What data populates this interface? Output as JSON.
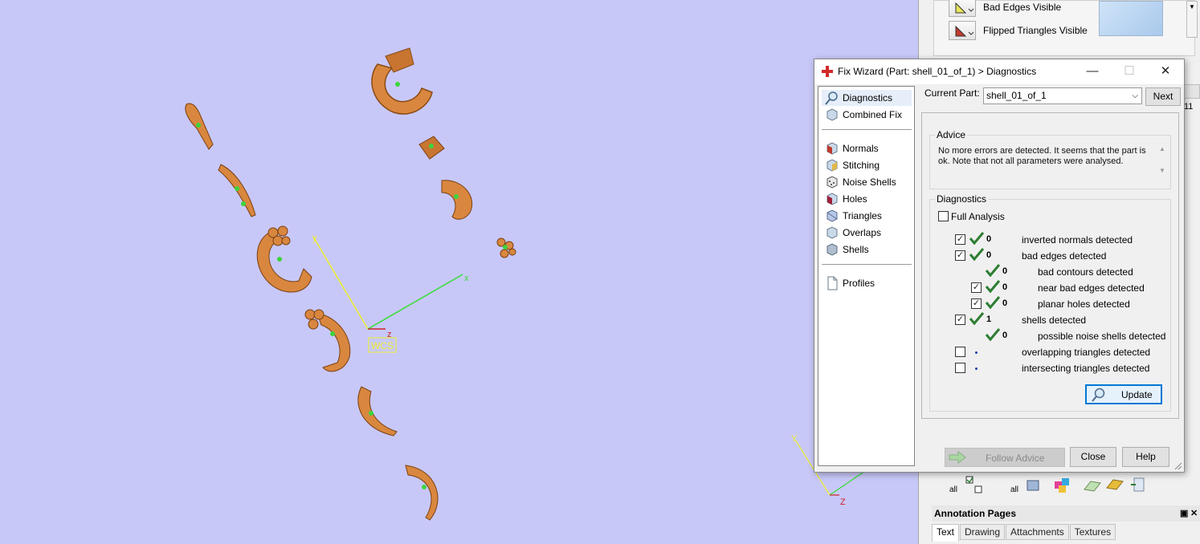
{
  "viewport": {
    "axis_labels": {
      "x": "x",
      "y": "y",
      "z": "z",
      "wcs": "WCS",
      "small_y": "Y",
      "small_z": "Z"
    }
  },
  "right_panel": {
    "bad_edges_label": "Bad Edges Visible",
    "flipped_label": "Flipped Triangles Visible",
    "tool_all_1": "all",
    "tool_all_2": "all",
    "annotation_title": "Annotation Pages",
    "annotation_tabs": [
      "Text",
      "Drawing",
      "Attachments",
      "Textures"
    ],
    "stub_tab_11": "11"
  },
  "dialog": {
    "title": "Fix Wizard (Part: shell_01_of_1) > Diagnostics",
    "nav": {
      "diagnostics": "Diagnostics",
      "combined_fix": "Combined Fix",
      "normals": "Normals",
      "stitching": "Stitching",
      "noise_shells": "Noise Shells",
      "holes": "Holes",
      "triangles": "Triangles",
      "overlaps": "Overlaps",
      "shells": "Shells",
      "profiles": "Profiles"
    },
    "current_part_label": "Current Part:",
    "current_part_value": "shell_01_of_1",
    "next_label": "Next",
    "advice_title": "Advice",
    "advice_text": "No more errors are detected. It seems that the part is ok. Note that not all parameters were analysed.",
    "diagnostics_title": "Diagnostics",
    "full_analysis_label": "Full Analysis",
    "rows": [
      {
        "count": "0",
        "label": "inverted normals detected"
      },
      {
        "count": "0",
        "label": "bad edges detected"
      },
      {
        "count": "0",
        "label": "bad contours detected"
      },
      {
        "count": "0",
        "label": "near bad edges detected"
      },
      {
        "count": "0",
        "label": "planar holes detected"
      },
      {
        "count": "1",
        "label": "shells detected"
      },
      {
        "count": "0",
        "label": "possible noise shells detected"
      },
      {
        "count": "",
        "label": "overlapping triangles detected"
      },
      {
        "count": "",
        "label": "intersecting triangles detected"
      }
    ],
    "update_label": "Update",
    "follow_advice_label": "Follow Advice",
    "close_label": "Close",
    "help_label": "Help"
  },
  "colors": {
    "viewport_bg": "#c8c8f8",
    "part_orange": "#d9873f",
    "tick_green": "#2e7d32",
    "accent_blue": "#0078d7"
  }
}
